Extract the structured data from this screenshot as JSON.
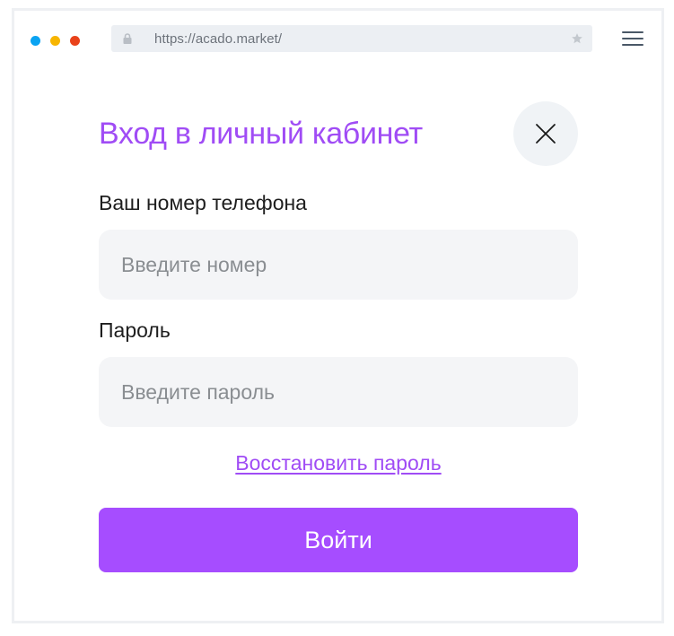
{
  "browser": {
    "url": "https://acado.market/",
    "icons": {
      "lock": "lock-icon",
      "bookmark": "star-icon",
      "menu": "hamburger-menu-icon"
    },
    "window_dots": [
      "#0aa3f2",
      "#f7b500",
      "#e9421b"
    ]
  },
  "modal": {
    "title": "Вход в личный кабинет",
    "close_icon": "close-icon",
    "phone": {
      "label": "Ваш номер телефона",
      "value": "",
      "placeholder": "Введите номер"
    },
    "password": {
      "label": "Пароль",
      "value": "",
      "placeholder": "Введите пароль"
    },
    "recover_link": "Восстановить пароль",
    "submit_label": "Войти"
  },
  "colors": {
    "accent": "#a04cf5",
    "button": "#a64dff",
    "input_bg": "#f4f5f7",
    "close_bg": "#f0f3f6"
  }
}
